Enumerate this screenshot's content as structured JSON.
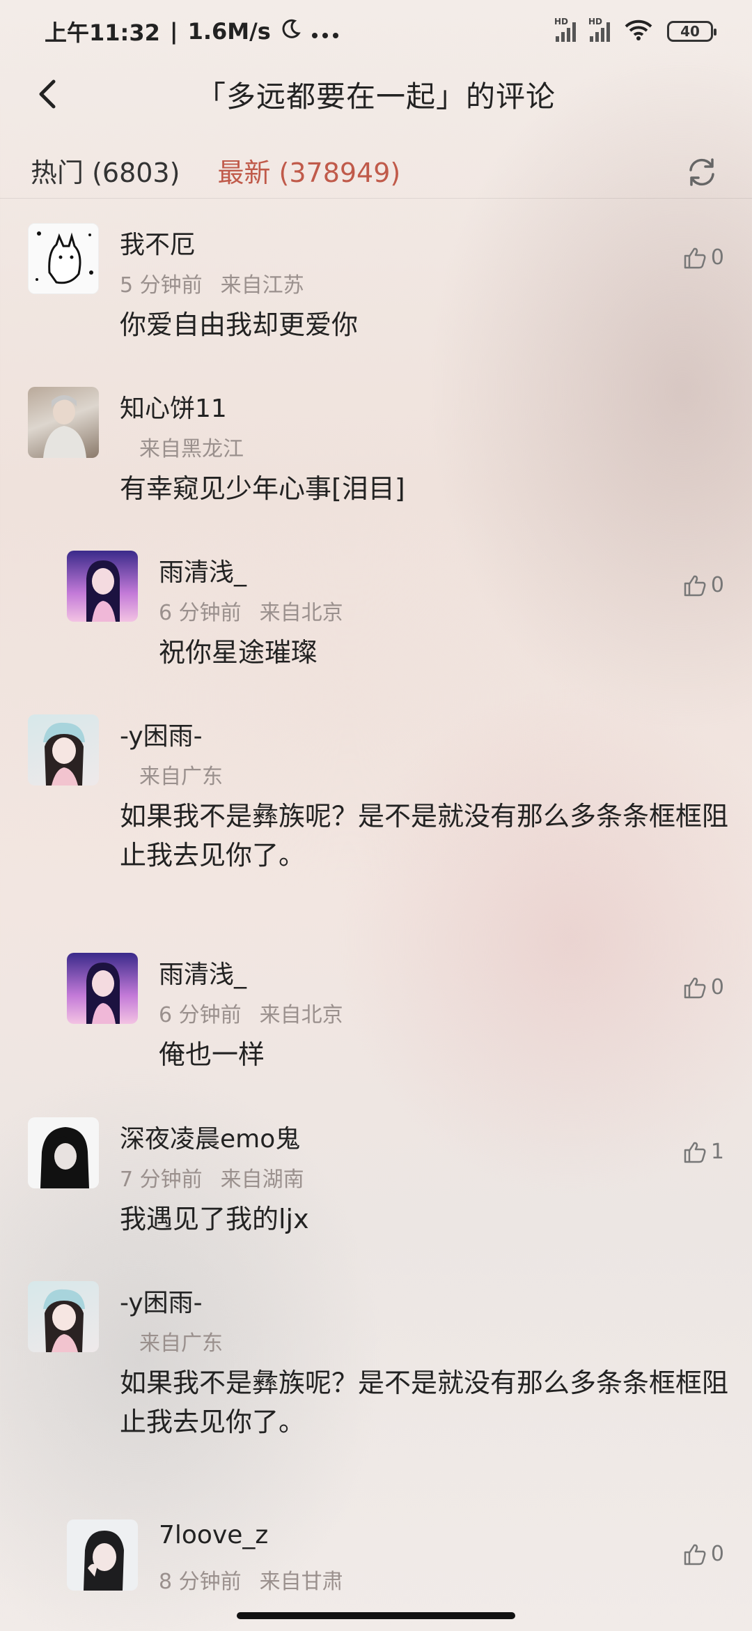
{
  "status_bar": {
    "time": "上午11:32",
    "speed": "1.6M/s",
    "battery": "40",
    "hd": "HD"
  },
  "header": {
    "title": "「多远都要在一起」的评论"
  },
  "tabs": {
    "hot": "热门 (6803)",
    "latest": "最新 (378949)"
  },
  "comments": [
    {
      "user": "我不厄",
      "time": "5 分钟前",
      "location": "来自江苏",
      "text": "你爱自由我却更爱你",
      "likes": "0"
    },
    {
      "user": "知心饼11",
      "time": "",
      "location": "来自黑龙江",
      "text": "有幸窥见少年心事[泪目]",
      "likes": ""
    },
    {
      "user": "雨清浅_",
      "time": "6 分钟前",
      "location": "来自北京",
      "text": "祝你星途璀璨",
      "likes": "0"
    },
    {
      "user": "-y困雨-",
      "time": "",
      "location": "来自广东",
      "text": "如果我不是彝族呢？是不是就没有那么多条条框框阻止我去见你了。",
      "likes": ""
    },
    {
      "user": "雨清浅_",
      "time": "6 分钟前",
      "location": "来自北京",
      "text": "俺也一样",
      "likes": "0"
    },
    {
      "user": "深夜凌晨emo鬼",
      "time": "7 分钟前",
      "location": "来自湖南",
      "text": "我遇见了我的ljx",
      "likes": "1"
    },
    {
      "user": "-y困雨-",
      "time": "",
      "location": "来自广东",
      "text": "如果我不是彝族呢？是不是就没有那么多条条框框阻止我去见你了。",
      "likes": ""
    },
    {
      "user": "7loove_z",
      "time": "8 分钟前",
      "location": "来自甘肃",
      "text": "",
      "likes": "0"
    }
  ]
}
